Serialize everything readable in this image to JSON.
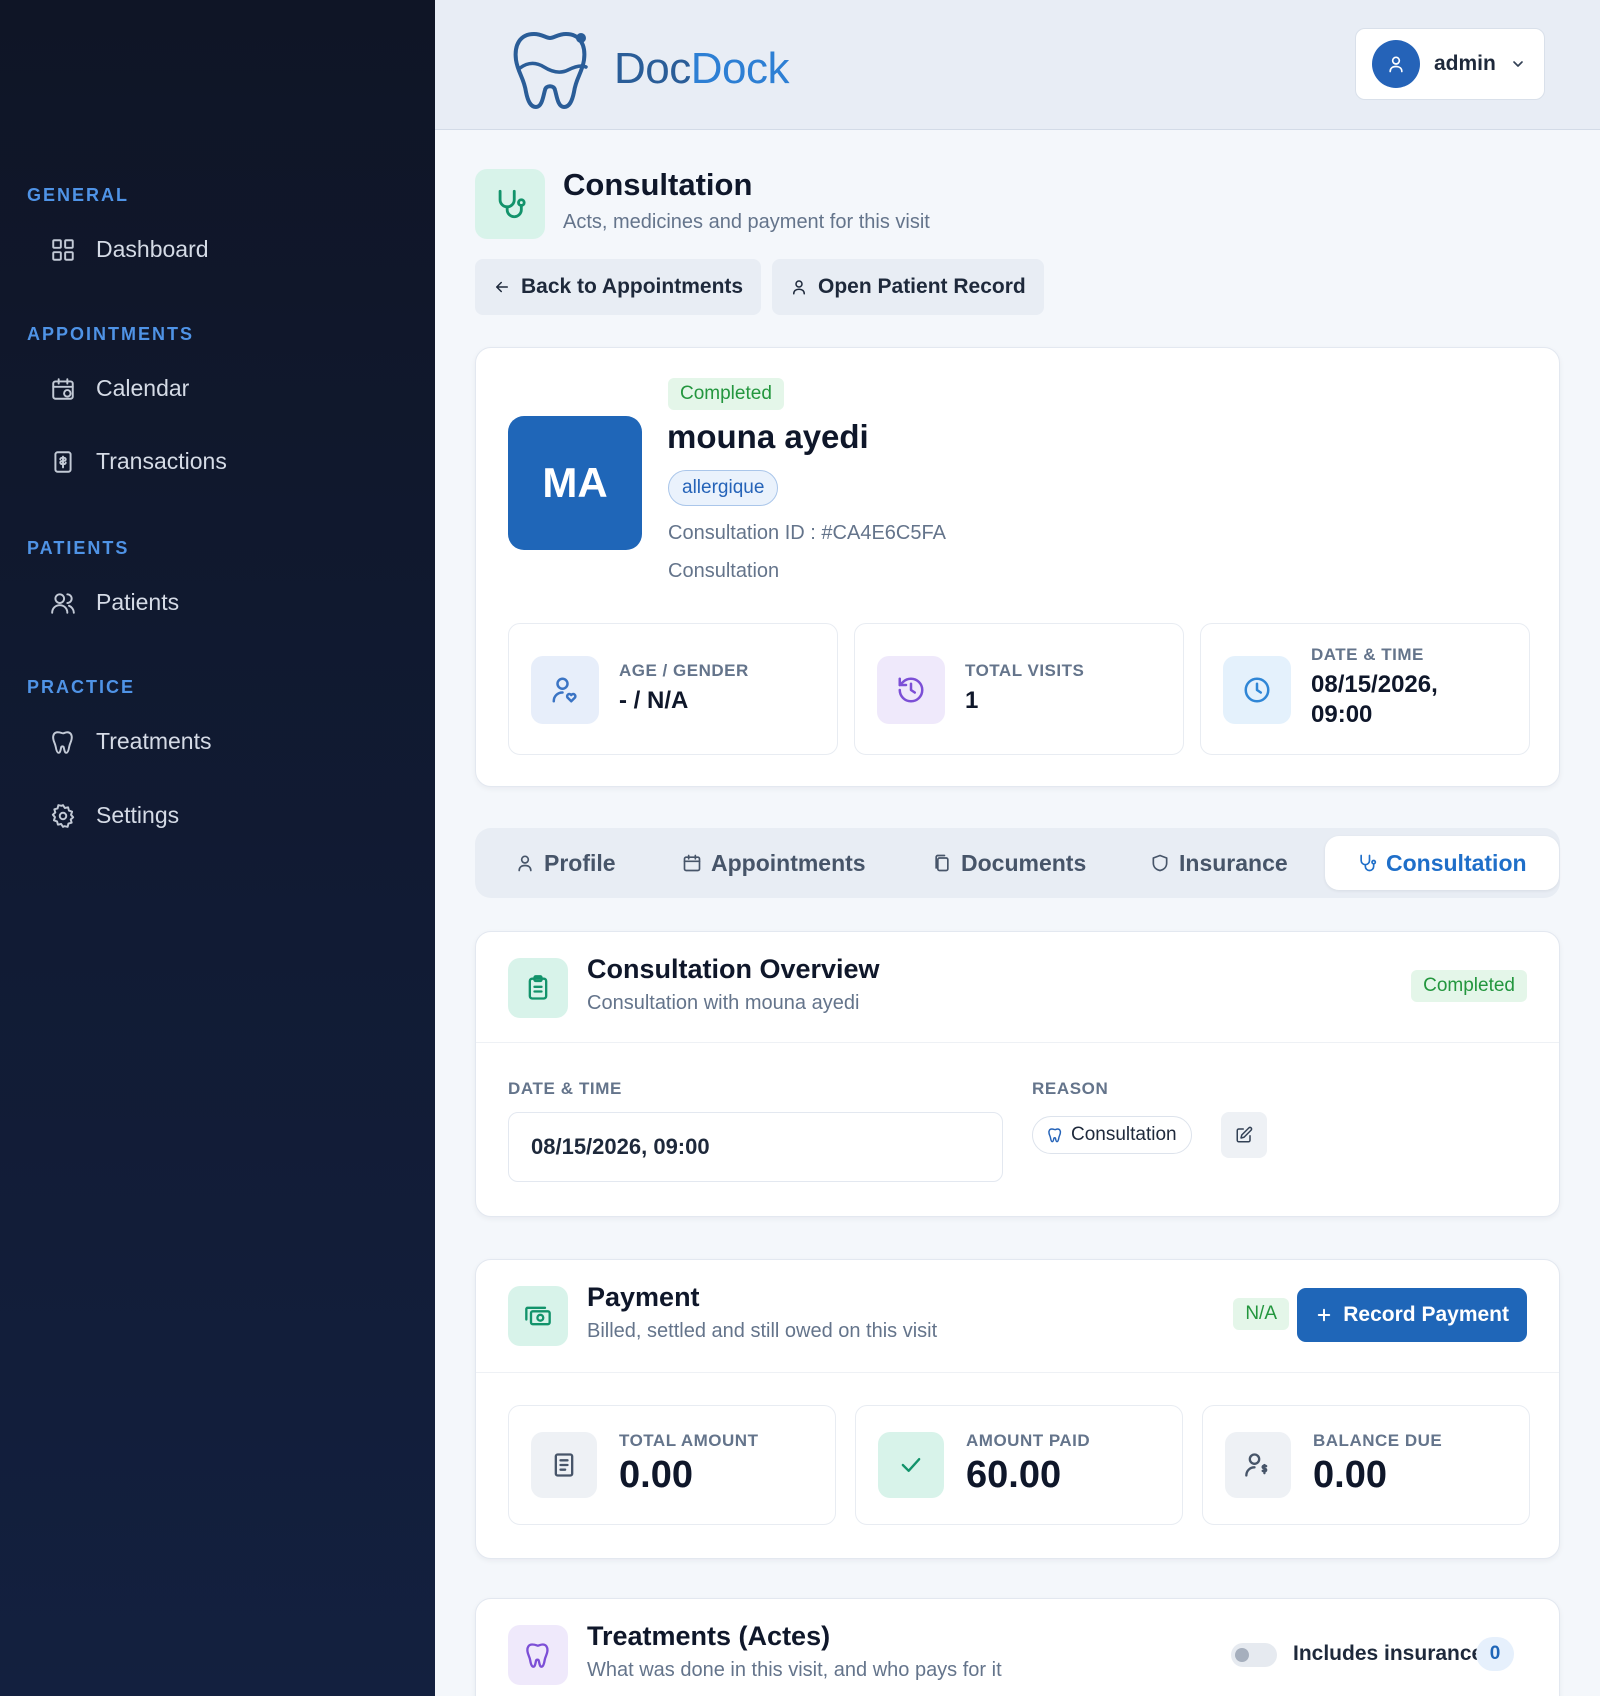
{
  "app": {
    "brand_part1": "Doc",
    "brand_part2": "Dock"
  },
  "user": {
    "name": "admin"
  },
  "sidebar": {
    "sections": [
      {
        "label": "GENERAL",
        "items": [
          {
            "label": "Dashboard",
            "icon": "dashboard-icon"
          }
        ]
      },
      {
        "label": "APPOINTMENTS",
        "items": [
          {
            "label": "Calendar",
            "icon": "calendar-icon"
          },
          {
            "label": "Transactions",
            "icon": "receipt-icon"
          }
        ]
      },
      {
        "label": "PATIENTS",
        "items": [
          {
            "label": "Patients",
            "icon": "users-icon"
          }
        ]
      },
      {
        "label": "PRACTICE",
        "items": [
          {
            "label": "Treatments",
            "icon": "tooth-icon"
          },
          {
            "label": "Settings",
            "icon": "gear-icon"
          }
        ]
      }
    ]
  },
  "page": {
    "title": "Consultation",
    "subtitle": "Acts, medicines and payment for this visit",
    "back_label": "Back to Appointments",
    "open_record_label": "Open Patient Record"
  },
  "patient": {
    "status": "Completed",
    "initials": "MA",
    "name": "mouna ayedi",
    "tag": "allergique",
    "consultation_id": "Consultation ID : #CA4E6C5FA",
    "type": "Consultation",
    "stats": {
      "age_gender": {
        "label": "AGE / GENDER",
        "value": "- / N/A"
      },
      "total_visits": {
        "label": "TOTAL VISITS",
        "value": "1"
      },
      "date_time": {
        "label": "DATE & TIME",
        "value_line1": "08/15/2026,",
        "value_line2": "09:00"
      }
    }
  },
  "tabs": [
    {
      "label": "Profile",
      "active": false
    },
    {
      "label": "Appointments",
      "active": false
    },
    {
      "label": "Documents",
      "active": false
    },
    {
      "label": "Insurance",
      "active": false
    },
    {
      "label": "Consultation",
      "active": true
    }
  ],
  "overview": {
    "title": "Consultation Overview",
    "subtitle": "Consultation with mouna ayedi",
    "status": "Completed",
    "date_label": "DATE & TIME",
    "date_value": "08/15/2026, 09:00",
    "reason_label": "REASON",
    "reason_value": "Consultation"
  },
  "payment": {
    "title": "Payment",
    "subtitle": "Billed, settled and still owed on this visit",
    "status": "N/A",
    "record_label": "Record Payment",
    "total": {
      "label": "TOTAL AMOUNT",
      "value": "0.00"
    },
    "paid": {
      "label": "AMOUNT PAID",
      "value": "60.00"
    },
    "balance": {
      "label": "BALANCE DUE",
      "value": "0.00"
    }
  },
  "treatments": {
    "title": "Treatments (Actes)",
    "subtitle": "What was done in this visit, and who pays for it",
    "insurance_label": "Includes insurance",
    "count": "0"
  },
  "colors": {
    "primary": "#1f66b8",
    "sidebar": "#111b34",
    "success": "#23963e"
  }
}
